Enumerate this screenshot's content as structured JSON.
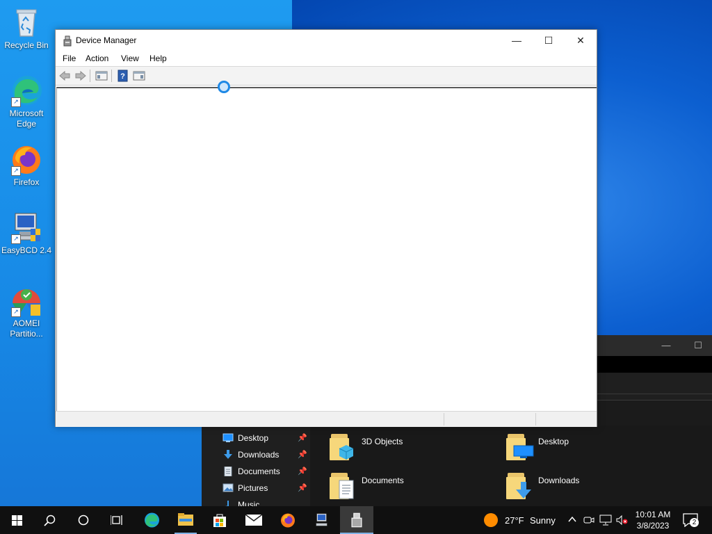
{
  "desktop": {
    "icons": [
      {
        "label": "Recycle Bin",
        "icon": "recycle-bin-icon"
      },
      {
        "label": "Microsoft Edge",
        "icon": "edge-icon"
      },
      {
        "label": "Firefox",
        "icon": "firefox-icon"
      },
      {
        "label": "EasyBCD 2.4",
        "icon": "easybcd-icon"
      },
      {
        "label": "AOMEI Partitio...",
        "icon": "aomei-icon"
      }
    ]
  },
  "device_manager": {
    "title": "Device Manager",
    "menu": [
      "File",
      "Action",
      "View",
      "Help"
    ],
    "toolbar": [
      "back-icon",
      "forward-icon",
      "show-hide-console-tree-icon",
      "help-icon",
      "show-hide-action-pane-icon"
    ],
    "controls": {
      "minimize": "—",
      "maximize": "☐",
      "close": "✕"
    }
  },
  "explorer": {
    "nav_items": [
      {
        "label": "Desktop",
        "pinned": true
      },
      {
        "label": "Downloads",
        "pinned": true
      },
      {
        "label": "Documents",
        "pinned": true
      },
      {
        "label": "Pictures",
        "pinned": true
      },
      {
        "label": "Music",
        "pinned": false
      }
    ],
    "folders": [
      {
        "label": "3D Objects"
      },
      {
        "label": "Desktop"
      },
      {
        "label": "Documents"
      },
      {
        "label": "Downloads"
      }
    ]
  },
  "taskbar": {
    "weather": {
      "temp": "27°F",
      "condition": "Sunny"
    },
    "clock": {
      "time": "10:01 AM",
      "date": "3/8/2023"
    },
    "notifications": "2",
    "colors": {
      "accent": "#7fb2e5",
      "background": "#101010"
    }
  }
}
